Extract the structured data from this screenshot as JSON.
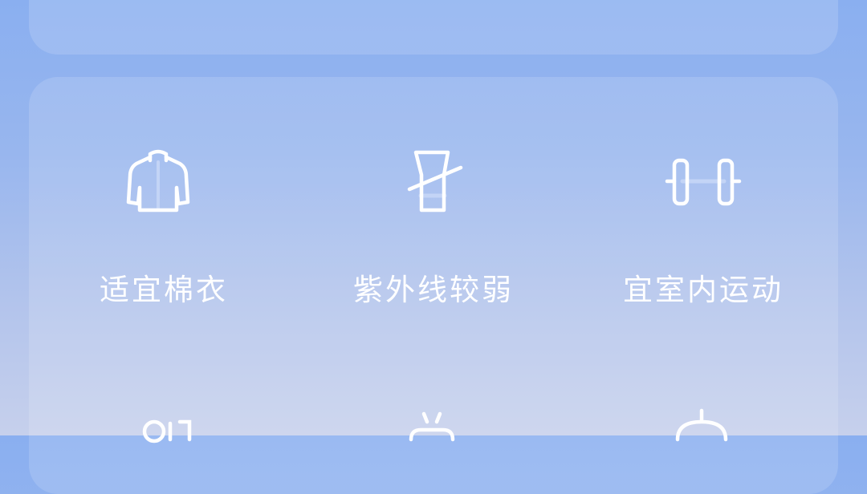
{
  "top_card": {
    "partial_text": ""
  },
  "tips": [
    {
      "label": "适宜棉衣",
      "icon": "jacket-icon"
    },
    {
      "label": "紫外线较弱",
      "icon": "sunscreen-icon"
    },
    {
      "label": "宜室内运动",
      "icon": "dumbbell-icon"
    }
  ],
  "tips_next_row_icons": [
    "people-icon",
    "teapot-icon",
    "umbrella-icon"
  ],
  "colors": {
    "background_top": "#8aaff0",
    "background_bottom": "#c6d0ec",
    "icon_accent": "#c3d4f6",
    "text": "#ffffff"
  }
}
